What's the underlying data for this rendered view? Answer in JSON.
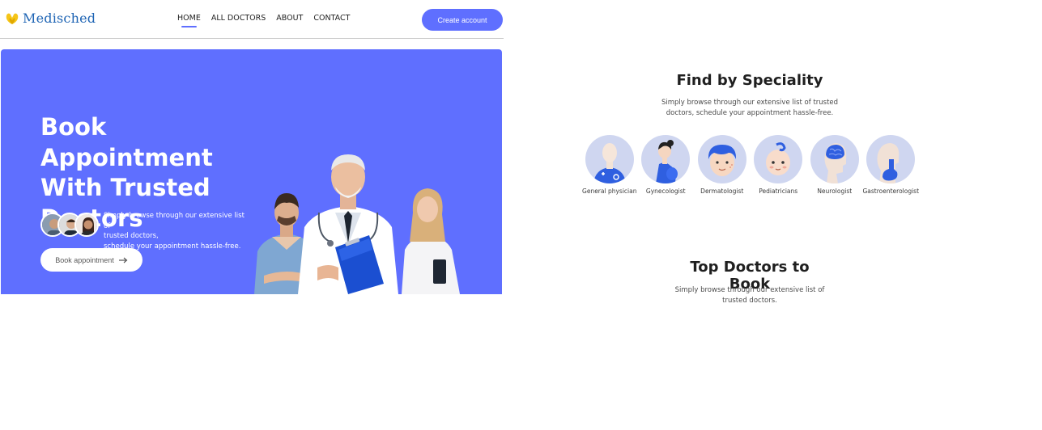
{
  "brand": {
    "name": "Medisched"
  },
  "nav": {
    "items": [
      {
        "label": "HOME",
        "active": true
      },
      {
        "label": "ALL DOCTORS",
        "active": false
      },
      {
        "label": "ABOUT",
        "active": false
      },
      {
        "label": "CONTACT",
        "active": false
      }
    ],
    "cta_label": "Create account"
  },
  "hero": {
    "title": "Book Appointment With Trusted Doctors",
    "desc_line1": "Simply browse through our extensive list of",
    "desc_line2": "trusted doctors,",
    "desc_line3": "schedule your appointment hassle-free.",
    "button_label": "Book appointment",
    "button_icon": "arrow-right-icon"
  },
  "speciality": {
    "title": "Find by Speciality",
    "desc_line1": "Simply browse through our extensive list of trusted",
    "desc_line2": "doctors, schedule your appointment hassle-free.",
    "items": [
      {
        "label": "General physician",
        "icon": "general-physician-icon"
      },
      {
        "label": "Gynecologist",
        "icon": "gynecologist-icon"
      },
      {
        "label": "Dermatologist",
        "icon": "dermatologist-icon"
      },
      {
        "label": "Pediatricians",
        "icon": "pediatrician-icon"
      },
      {
        "label": "Neurologist",
        "icon": "neurologist-icon"
      },
      {
        "label": "Gastroenterologist",
        "icon": "gastroenterologist-icon"
      }
    ]
  },
  "top_doctors": {
    "title": "Top Doctors to Book",
    "desc_line1": "Simply browse through our extensive list of",
    "desc_line2": "trusted doctors."
  },
  "colors": {
    "primary": "#5f6fff",
    "icon_bg": "#cfd6f0",
    "logo_text": "#1e64b4",
    "logo_mark": "#f5c518"
  }
}
